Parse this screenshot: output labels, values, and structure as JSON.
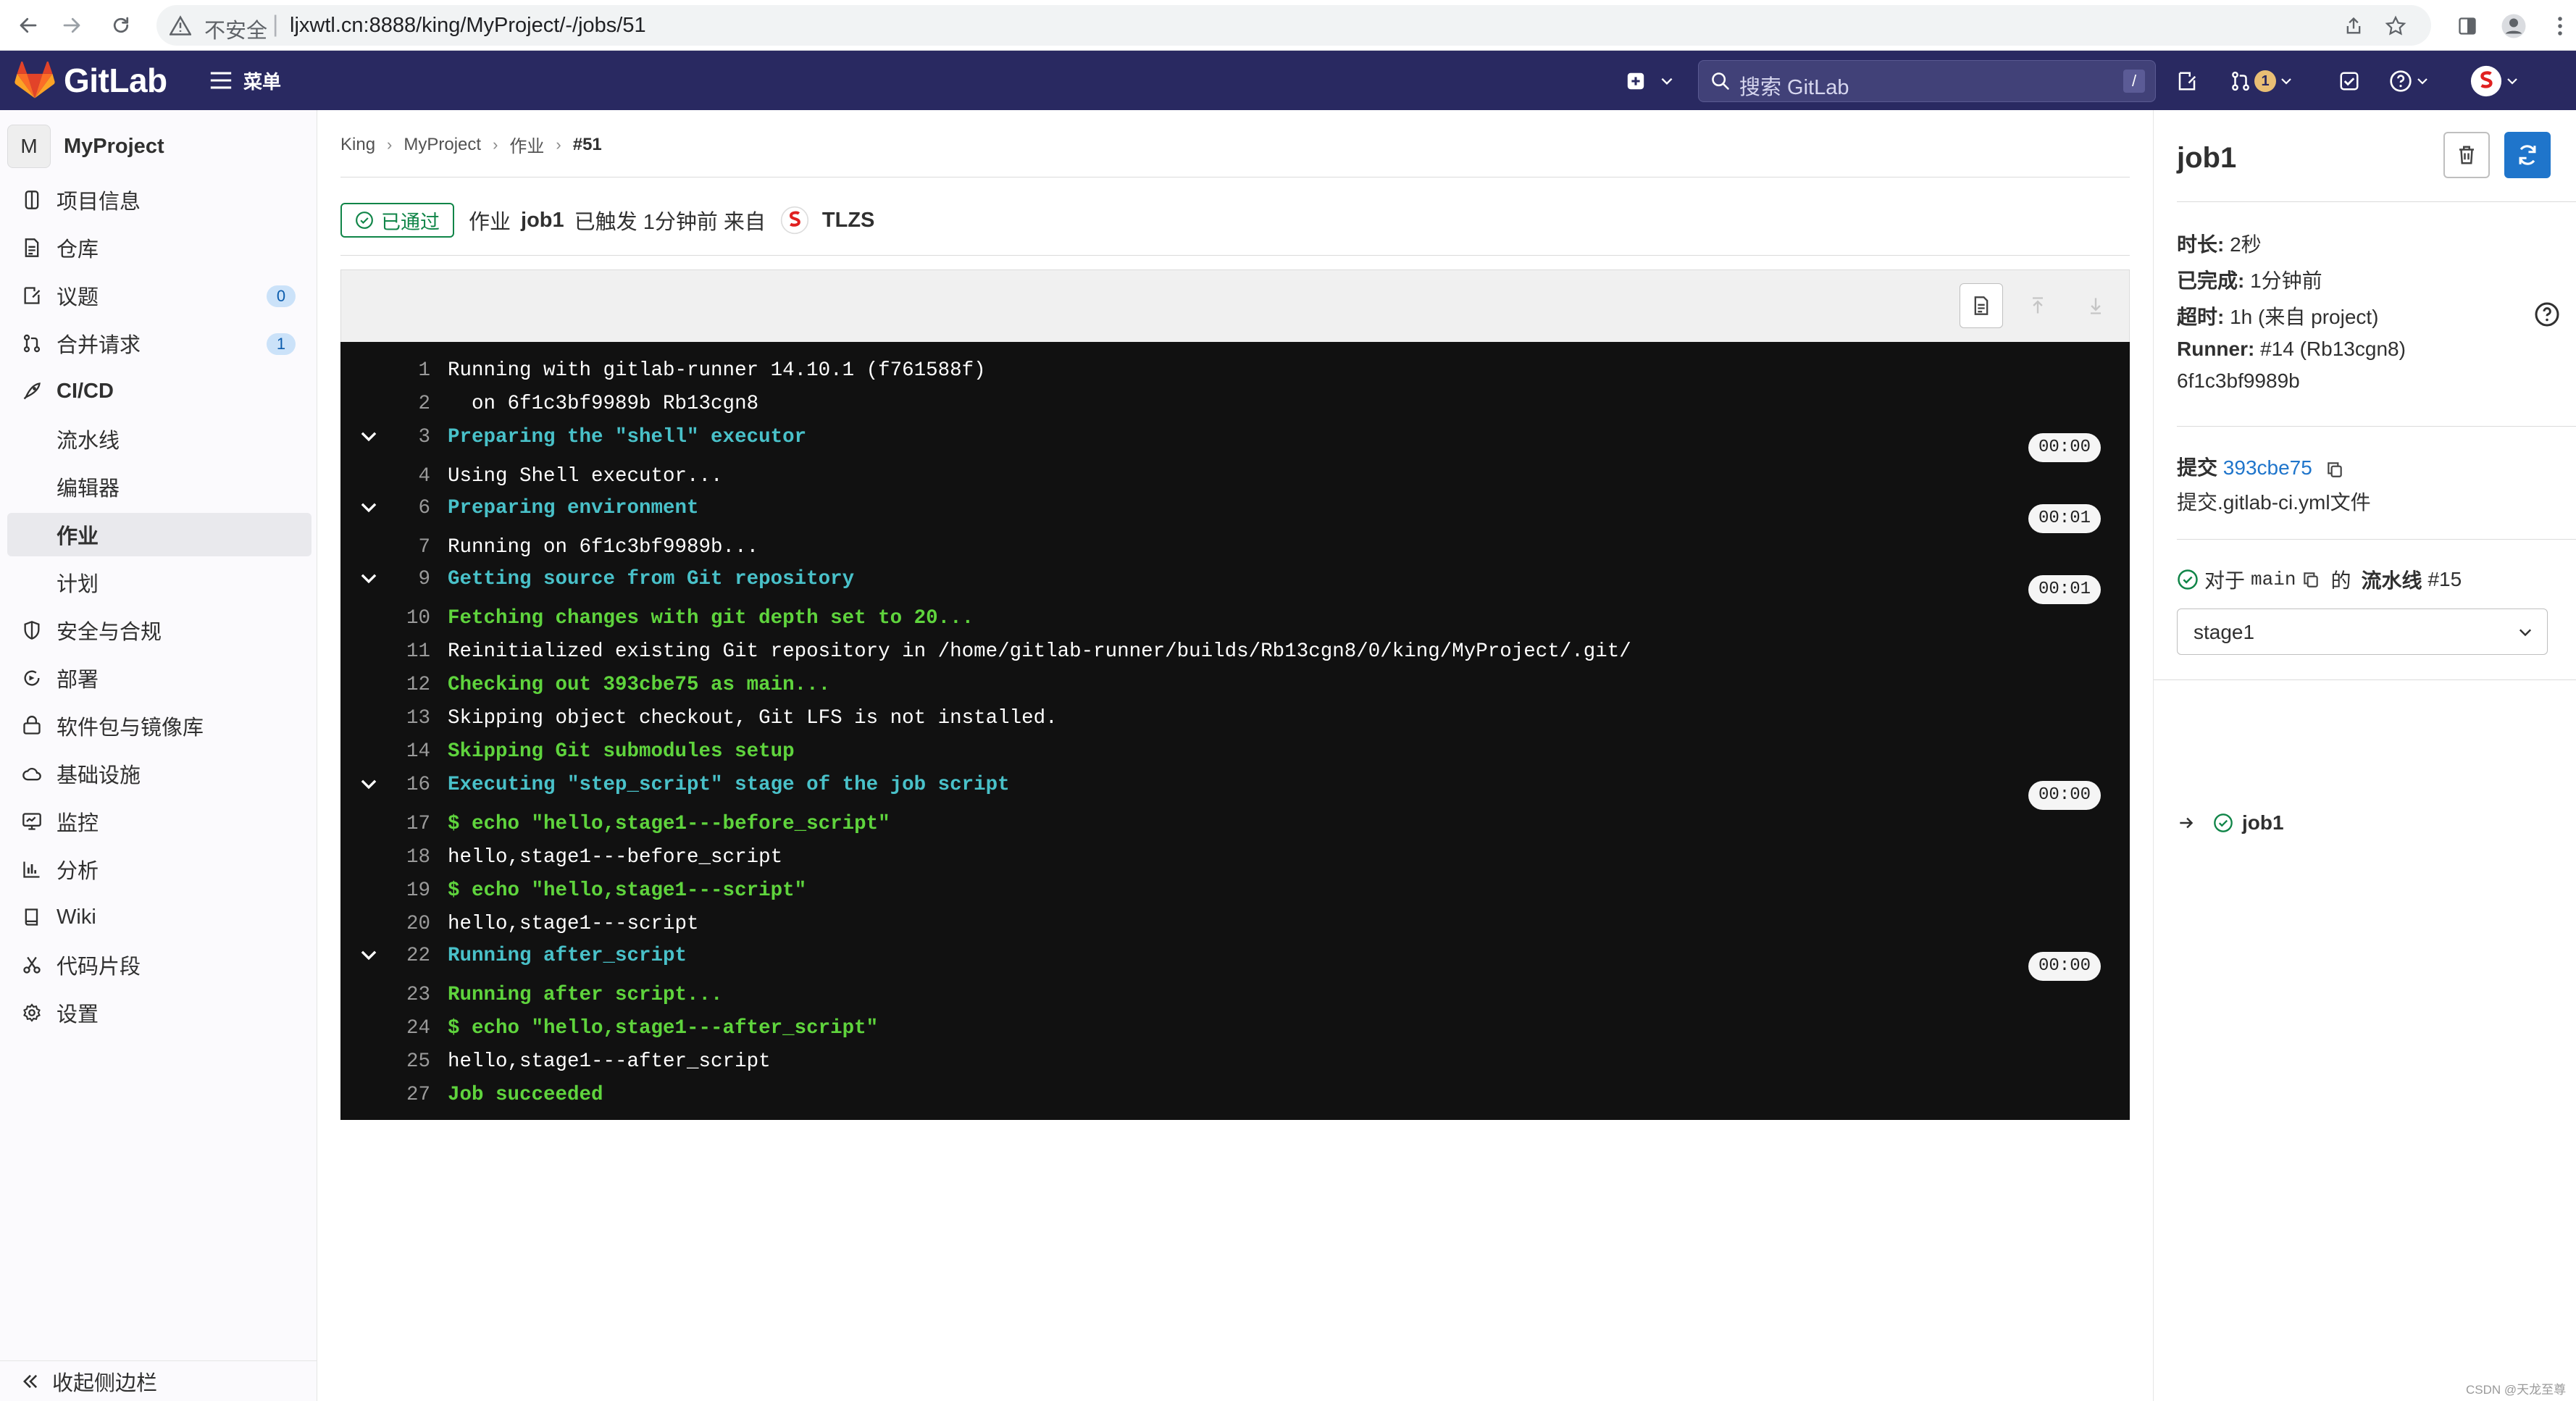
{
  "browser": {
    "insecure_label": "不安全",
    "url": "ljxwtl.cn:8888/king/MyProject/-/jobs/51"
  },
  "topnav": {
    "brand": "GitLab",
    "menu_label": "菜单",
    "search_placeholder": "搜索 GitLab",
    "search_shortcut": "/",
    "merge_request_count": "1"
  },
  "sidebar": {
    "project_initial": "M",
    "project_name": "MyProject",
    "items": [
      {
        "label": "项目信息",
        "icon": "info-icon"
      },
      {
        "label": "仓库",
        "icon": "document-icon"
      },
      {
        "label": "议题",
        "icon": "issues-icon",
        "badge": "0"
      },
      {
        "label": "合并请求",
        "icon": "merge-request-icon",
        "badge": "1"
      },
      {
        "label": "CI/CD",
        "icon": "rocket-icon"
      },
      {
        "label": "流水线"
      },
      {
        "label": "编辑器"
      },
      {
        "label": "作业"
      },
      {
        "label": "计划"
      },
      {
        "label": "安全与合规",
        "icon": "shield-icon"
      },
      {
        "label": "部署",
        "icon": "deploy-icon"
      },
      {
        "label": "软件包与镜像库",
        "icon": "package-icon"
      },
      {
        "label": "基础设施",
        "icon": "cloud-icon"
      },
      {
        "label": "监控",
        "icon": "monitor-icon"
      },
      {
        "label": "分析",
        "icon": "chart-icon"
      },
      {
        "label": "Wiki",
        "icon": "book-icon"
      },
      {
        "label": "代码片段",
        "icon": "scissors-icon"
      },
      {
        "label": "设置",
        "icon": "gear-icon"
      }
    ],
    "collapse_label": "收起侧边栏"
  },
  "breadcrumb": [
    "King",
    "MyProject",
    "作业",
    "#51"
  ],
  "job_header": {
    "status": "已通过",
    "prefix": "作业",
    "job_name": "job1",
    "suffix": "已触发 1分钟前 来自",
    "user": "TLZS"
  },
  "log": [
    {
      "n": "1",
      "text": "Running with gitlab-runner 14.10.1 (f761588f)",
      "style": "plain"
    },
    {
      "n": "2",
      "text": "  on 6f1c3bf9989b Rb13cgn8",
      "style": "plain"
    },
    {
      "n": "3",
      "text": "Preparing the \"shell\" executor",
      "style": "section",
      "duration": "00:00"
    },
    {
      "n": "4",
      "text": "Using Shell executor...",
      "style": "plain"
    },
    {
      "n": "6",
      "text": "Preparing environment",
      "style": "section",
      "duration": "00:01"
    },
    {
      "n": "7",
      "text": "Running on 6f1c3bf9989b...",
      "style": "plain"
    },
    {
      "n": "9",
      "text": "Getting source from Git repository",
      "style": "section",
      "duration": "00:01"
    },
    {
      "n": "10",
      "text": "Fetching changes with git depth set to 20...",
      "style": "green"
    },
    {
      "n": "11",
      "text": "Reinitialized existing Git repository in /home/gitlab-runner/builds/Rb13cgn8/0/king/MyProject/.git/",
      "style": "plain"
    },
    {
      "n": "12",
      "text": "Checking out 393cbe75 as main...",
      "style": "green"
    },
    {
      "n": "13",
      "text": "Skipping object checkout, Git LFS is not installed.",
      "style": "plain"
    },
    {
      "n": "14",
      "text": "Skipping Git submodules setup",
      "style": "green"
    },
    {
      "n": "16",
      "text": "Executing \"step_script\" stage of the job script",
      "style": "section",
      "duration": "00:00"
    },
    {
      "n": "17",
      "text": "$ echo \"hello,stage1---before_script\"",
      "style": "green"
    },
    {
      "n": "18",
      "text": "hello,stage1---before_script",
      "style": "plain"
    },
    {
      "n": "19",
      "text": "$ echo \"hello,stage1---script\"",
      "style": "green"
    },
    {
      "n": "20",
      "text": "hello,stage1---script",
      "style": "plain"
    },
    {
      "n": "22",
      "text": "Running after_script",
      "style": "section",
      "duration": "00:00"
    },
    {
      "n": "23",
      "text": "Running after script...",
      "style": "green"
    },
    {
      "n": "24",
      "text": "$ echo \"hello,stage1---after_script\"",
      "style": "green"
    },
    {
      "n": "25",
      "text": "hello,stage1---after_script",
      "style": "plain"
    },
    {
      "n": "27",
      "text": "Job succeeded",
      "style": "green"
    }
  ],
  "right_sidebar": {
    "title": "job1",
    "duration_label": "时长:",
    "duration_value": "2秒",
    "finished_label": "已完成:",
    "finished_value": "1分钟前",
    "timeout_label": "超时:",
    "timeout_value": "1h (来自 project)",
    "runner_label": "Runner:",
    "runner_value": "#14 (Rb13cgn8)",
    "runner_id": "6f1c3bf9989b",
    "commit_label": "提交",
    "commit_sha": "393cbe75",
    "commit_message": "提交.gitlab-ci.yml文件",
    "pipeline_for": "对于",
    "pipeline_branch": "main",
    "pipeline_of": "的",
    "pipeline_label": "流水线",
    "pipeline_id": "#15",
    "stage": "stage1",
    "job": "job1"
  },
  "watermark": "CSDN @天龙至尊",
  "colors": {
    "navbar": "#292961",
    "success": "#108548",
    "link": "#1f75cb",
    "log_bg": "#111111",
    "log_section": "#49c1c9",
    "log_green": "#5fd43d"
  }
}
